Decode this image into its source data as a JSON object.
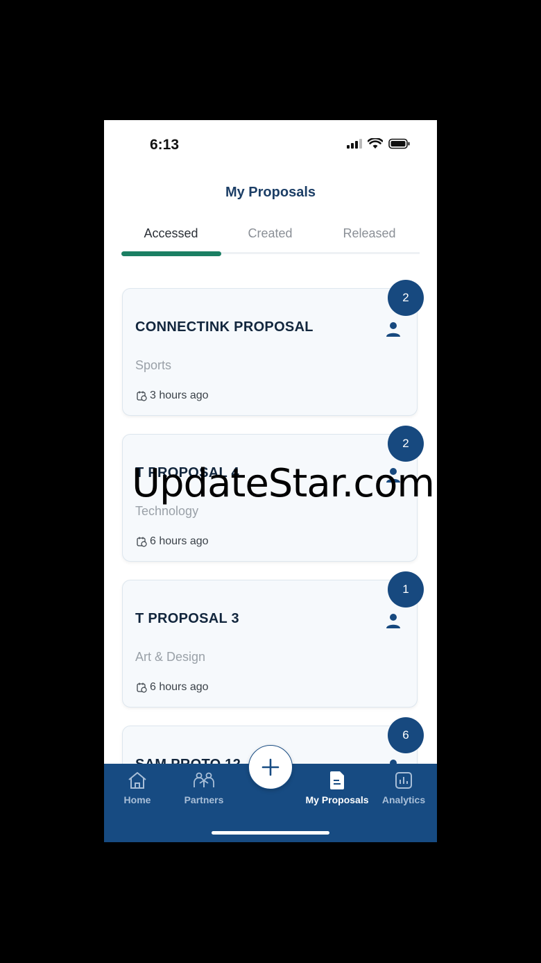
{
  "status_bar": {
    "time": "6:13"
  },
  "header": {
    "title": "My Proposals"
  },
  "tabs": [
    {
      "label": "Accessed",
      "active": true
    },
    {
      "label": "Created",
      "active": false
    },
    {
      "label": "Released",
      "active": false
    }
  ],
  "proposals": [
    {
      "title": "CONNECTINK PROPOSAL",
      "category": "Sports",
      "time": "3 hours ago",
      "count": "2"
    },
    {
      "title": "T PROPOSAL 4",
      "category": "Technology",
      "time": "6 hours ago",
      "count": "2"
    },
    {
      "title": "T PROPOSAL 3",
      "category": "Art & Design",
      "time": "6 hours ago",
      "count": "1"
    },
    {
      "title": "SAM PROTO 12",
      "category": "",
      "time": "",
      "count": "6"
    }
  ],
  "nav": {
    "home": "Home",
    "partners": "Partners",
    "my_proposals": "My Proposals",
    "analytics": "Analytics"
  },
  "watermark": "UpdateStar.com",
  "colors": {
    "primary": "#174b82",
    "accent": "#1b7f63",
    "title": "#1c3e66"
  }
}
